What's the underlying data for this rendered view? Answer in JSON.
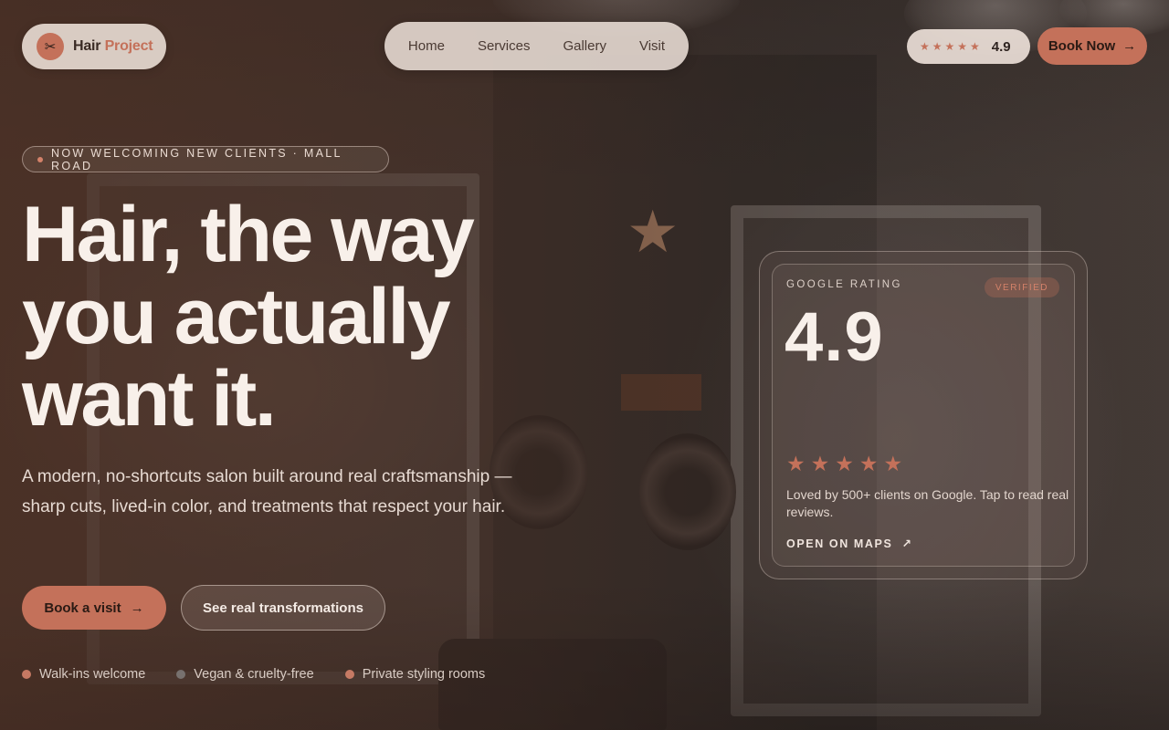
{
  "brand": {
    "icon": "scissors-icon",
    "name_main": "Hair",
    "name_accent": "Project",
    "accent_color": "#c4715a"
  },
  "nav": {
    "items": [
      "Home",
      "Services",
      "Gallery",
      "Visit"
    ]
  },
  "header_rating": {
    "stars": "★★★★★",
    "value": "4.9"
  },
  "book_now": {
    "label": "Book Now",
    "icon": "arrow-right-icon"
  },
  "hero": {
    "eyebrow": "NOW WELCOMING NEW CLIENTS · MALL ROAD",
    "headline_lines": [
      "Hair, the way",
      "you actually",
      "want it."
    ],
    "subtitle": "A modern, no-shortcuts salon built around real craftsmanship — sharp cuts, lived-in color, and treatments that respect your hair.",
    "primary_cta": "Book a visit",
    "secondary_cta": "See real transformations",
    "features": [
      {
        "label": "Walk-ins welcome",
        "color": "#d4826a"
      },
      {
        "label": "Vegan & cruelty-free",
        "color": "#8a8a8a"
      },
      {
        "label": "Private styling rooms",
        "color": "#d4826a"
      }
    ]
  },
  "rating_card": {
    "label": "GOOGLE RATING",
    "badge": "VERIFIED",
    "value": "4.9",
    "stars": "★★★★★",
    "description": "Loved by 500+ clients on Google. Tap to read real reviews.",
    "link": "OPEN ON MAPS",
    "link_icon": "arrow-up-right-icon"
  }
}
